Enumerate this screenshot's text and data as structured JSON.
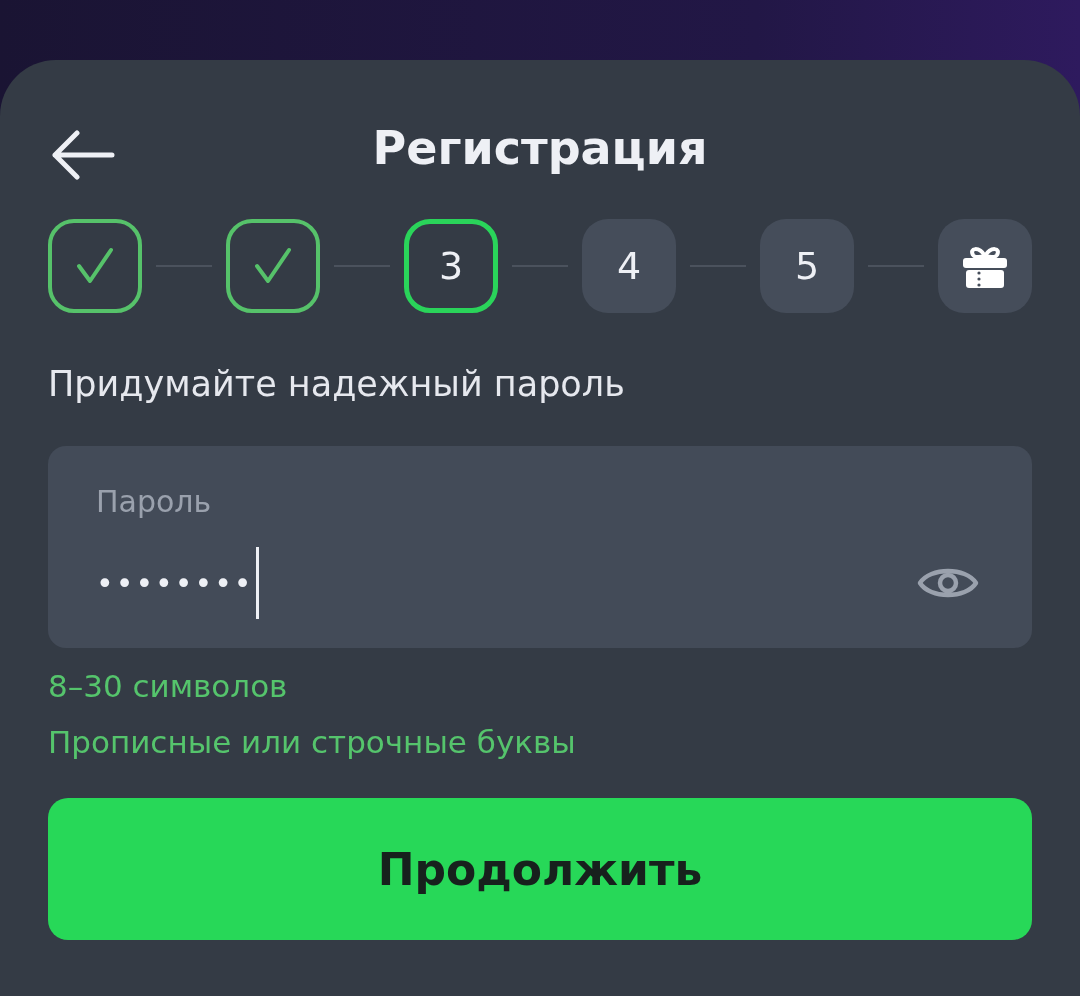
{
  "header": {
    "title": "Регистрация"
  },
  "steps": [
    {
      "kind": "done"
    },
    {
      "kind": "done"
    },
    {
      "kind": "current",
      "label": "3"
    },
    {
      "kind": "upcoming",
      "label": "4"
    },
    {
      "kind": "upcoming",
      "label": "5"
    },
    {
      "kind": "gift"
    }
  ],
  "prompt": "Придумайте надежный пароль",
  "password_field": {
    "label": "Пароль",
    "value": "••••••••",
    "focused": true
  },
  "hints": [
    {
      "text": "8–30 символов",
      "met": true
    },
    {
      "text": "Прописные или строчные буквы",
      "met": true
    }
  ],
  "buttons": [
    {
      "label": "Продолжить"
    }
  ]
}
